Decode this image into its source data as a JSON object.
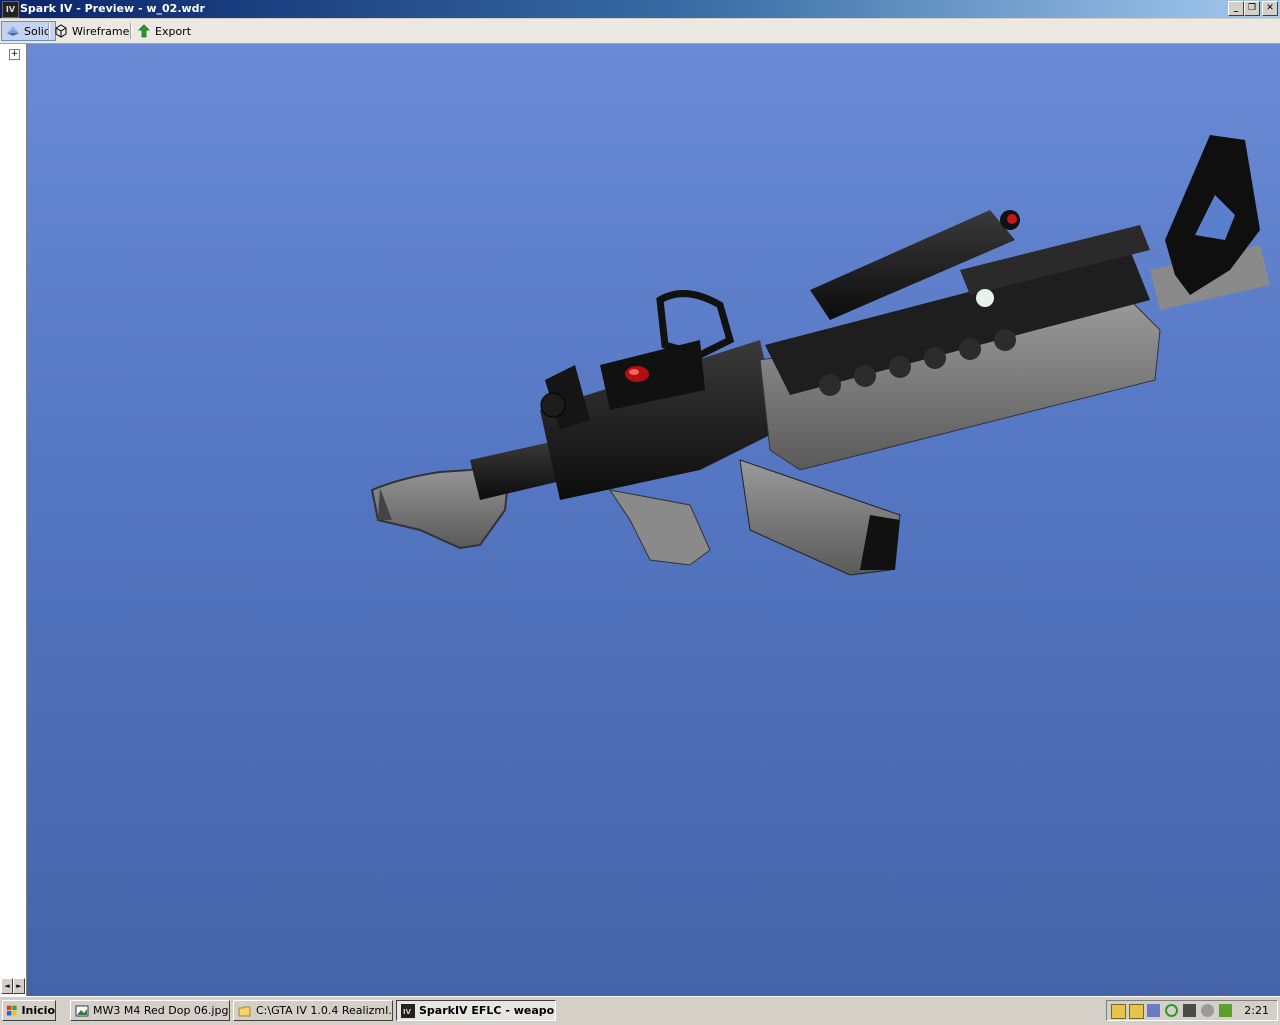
{
  "window": {
    "app_icon": "IV",
    "title": "Spark IV - Preview - w_02.wdr",
    "controls": [
      "_",
      "❐",
      "✕"
    ]
  },
  "toolbar": {
    "solid_label": "Solid",
    "wireframe_label": "Wireframe",
    "export_label": "Export"
  },
  "left_panel": {
    "expander": "+",
    "scroll_left": "◄",
    "scroll_right": "►"
  },
  "viewport": {
    "model": "w_02.wdr (M4 carbine with red dot sight)",
    "background_top": "#6a8ad6",
    "background_bottom": "#4563a8"
  },
  "taskbar": {
    "start_label": "Inicio",
    "items": [
      {
        "label": "MW3 M4 Red Dop 06.jpg...",
        "icon": "image-icon",
        "active": false
      },
      {
        "label": "C:\\GTA IV 1.0.4 RealizmI...",
        "icon": "folder-icon",
        "active": false
      },
      {
        "label": "SparkIV EFLC - weapo...",
        "icon": "sparkiv-icon",
        "active": true
      }
    ],
    "clock": "2:21"
  }
}
